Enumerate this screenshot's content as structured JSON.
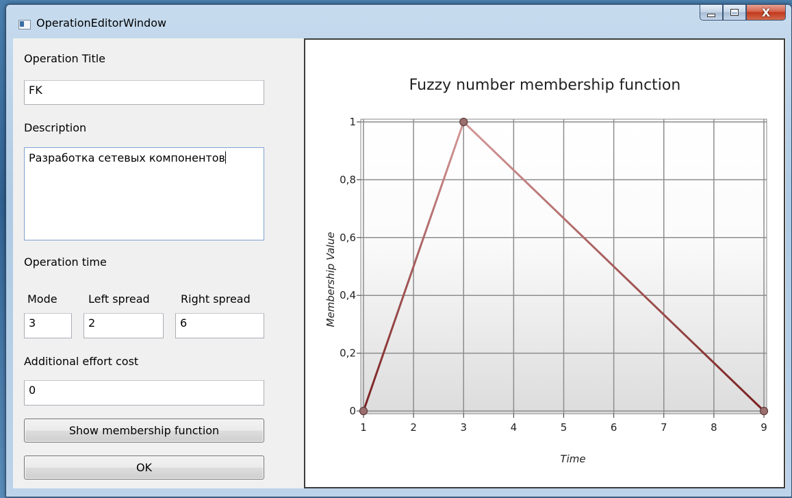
{
  "window": {
    "title": "OperationEditorWindow",
    "close_glyph": "X"
  },
  "form": {
    "operation_title_label": "Operation Title",
    "operation_title_value": "FK",
    "description_label": "Description",
    "description_value": "Разработка сетевых компонентов",
    "operation_time_label": "Operation time",
    "mode_label": "Mode",
    "left_spread_label": "Left spread",
    "right_spread_label": "Right spread",
    "mode_value": "3",
    "left_spread_value": "2",
    "right_spread_value": "6",
    "effort_label": "Additional effort cost",
    "effort_value": "0",
    "show_button": "Show membership function",
    "ok_button": "OK"
  },
  "colors": {
    "line": "#8b2c2c",
    "marker": "#9c6f6f"
  },
  "chart_data": {
    "type": "line",
    "title": "Fuzzy number membership function",
    "xlabel": "Time",
    "ylabel": "Membership Value",
    "xlim": [
      1,
      9
    ],
    "ylim": [
      0,
      1
    ],
    "xticks": [
      1,
      2,
      3,
      4,
      5,
      6,
      7,
      8,
      9
    ],
    "yticks": [
      "0",
      "0,2",
      "0,4",
      "0,6",
      "0,8",
      "1"
    ],
    "grid": true,
    "series": [
      {
        "x": [
          1,
          3,
          9
        ],
        "y": [
          0,
          1,
          0
        ]
      }
    ]
  }
}
